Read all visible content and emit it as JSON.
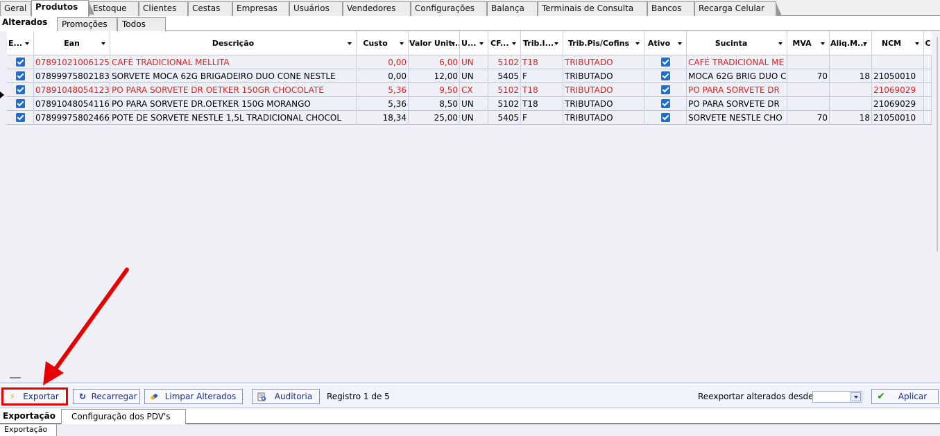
{
  "top_tabs": [
    "Geral",
    "Produtos",
    "Estoque",
    "Clientes",
    "Cestas",
    "Empresas",
    "Usuários",
    "Vendedores",
    "Configurações",
    "Balança",
    "Terminais de Consulta",
    "Bancos",
    "Recarga Celular"
  ],
  "sub_tabs": [
    "Alterados",
    "Promoções",
    "Todos"
  ],
  "columns": [
    "E...",
    "Ean",
    "Descrição",
    "Custo",
    "Valor Unit...",
    "U...",
    "CF...",
    "Trib.I...",
    "Trib.Pis/Cofins",
    "Ativo",
    "Sucinta",
    "MVA",
    "Aliq.M...",
    "NCM",
    "C"
  ],
  "rows": [
    {
      "ean": "07891021006125",
      "descricao": "CAFÉ TRADICIONAL MELLITA",
      "custo": "0,00",
      "valor": "6,00",
      "un": "UN",
      "cf": "5102",
      "trib": "T18",
      "pis": "TRIBUTADO",
      "sucinta": "CAFÉ TRADICIONAL ME",
      "mva": "",
      "aliq": "",
      "ncm": "",
      "red": true
    },
    {
      "ean": "07899975802183",
      "descricao": "SORVETE MOCA 62G BRIGADEIRO DUO CONE NESTLE",
      "custo": "0,00",
      "valor": "12,00",
      "un": "UN",
      "cf": "5405",
      "trib": "F",
      "pis": "TRIBUTADO",
      "sucinta": "MOCA 62G BRIG DUO C",
      "mva": "70",
      "aliq": "18",
      "ncm": "21050010",
      "red": false
    },
    {
      "ean": "07891048054123",
      "descricao": "PO PARA SORVETE DR OETKER 150GR CHOCOLATE",
      "custo": "5,36",
      "valor": "9,50",
      "un": "CX",
      "cf": "5102",
      "trib": "T18",
      "pis": "TRIBUTADO",
      "sucinta": "PO PARA SORVETE DR",
      "mva": "",
      "aliq": "",
      "ncm": "21069029",
      "red": true
    },
    {
      "ean": "07891048054116",
      "descricao": "PO PARA SORVETE DR.OETKER 150G MORANGO",
      "custo": "5,36",
      "valor": "8,50",
      "un": "UN",
      "cf": "5102",
      "trib": "T18",
      "pis": "TRIBUTADO",
      "sucinta": "PO PARA SORVETE DR",
      "mva": "",
      "aliq": "",
      "ncm": "21069029",
      "red": false
    },
    {
      "ean": "07899975802466",
      "descricao": "POTE DE SORVETE NESTLE 1,5L TRADICIONAL CHOCOL",
      "custo": "18,34",
      "valor": "25,00",
      "un": "UN",
      "cf": "5405",
      "trib": "F",
      "pis": "TRIBUTADO",
      "sucinta": "SORVETE NESTLE CHO",
      "mva": "70",
      "aliq": "18",
      "ncm": "21050010",
      "red": false
    }
  ],
  "toolbar": {
    "exportar": "Exportar",
    "recarregar": "Recarregar",
    "limpar": "Limpar Alterados",
    "auditoria": "Auditoria",
    "registro": "Registro 1 de 5",
    "reexportar": "Reexportar alterados desde",
    "aplicar": "Aplicar"
  },
  "bottom_tabs": [
    "Exportação",
    "Configuração dos PDV's"
  ],
  "bottom_sub_tab": "Exportação",
  "colors": {
    "red_text": "#e02020",
    "highlight": "#e60000",
    "check": "#1a6fd0"
  },
  "icons": [
    "lightning-icon",
    "reload-icon",
    "eraser-icon",
    "audit-icon",
    "check-icon",
    "dropdown-arrow-icon"
  ]
}
